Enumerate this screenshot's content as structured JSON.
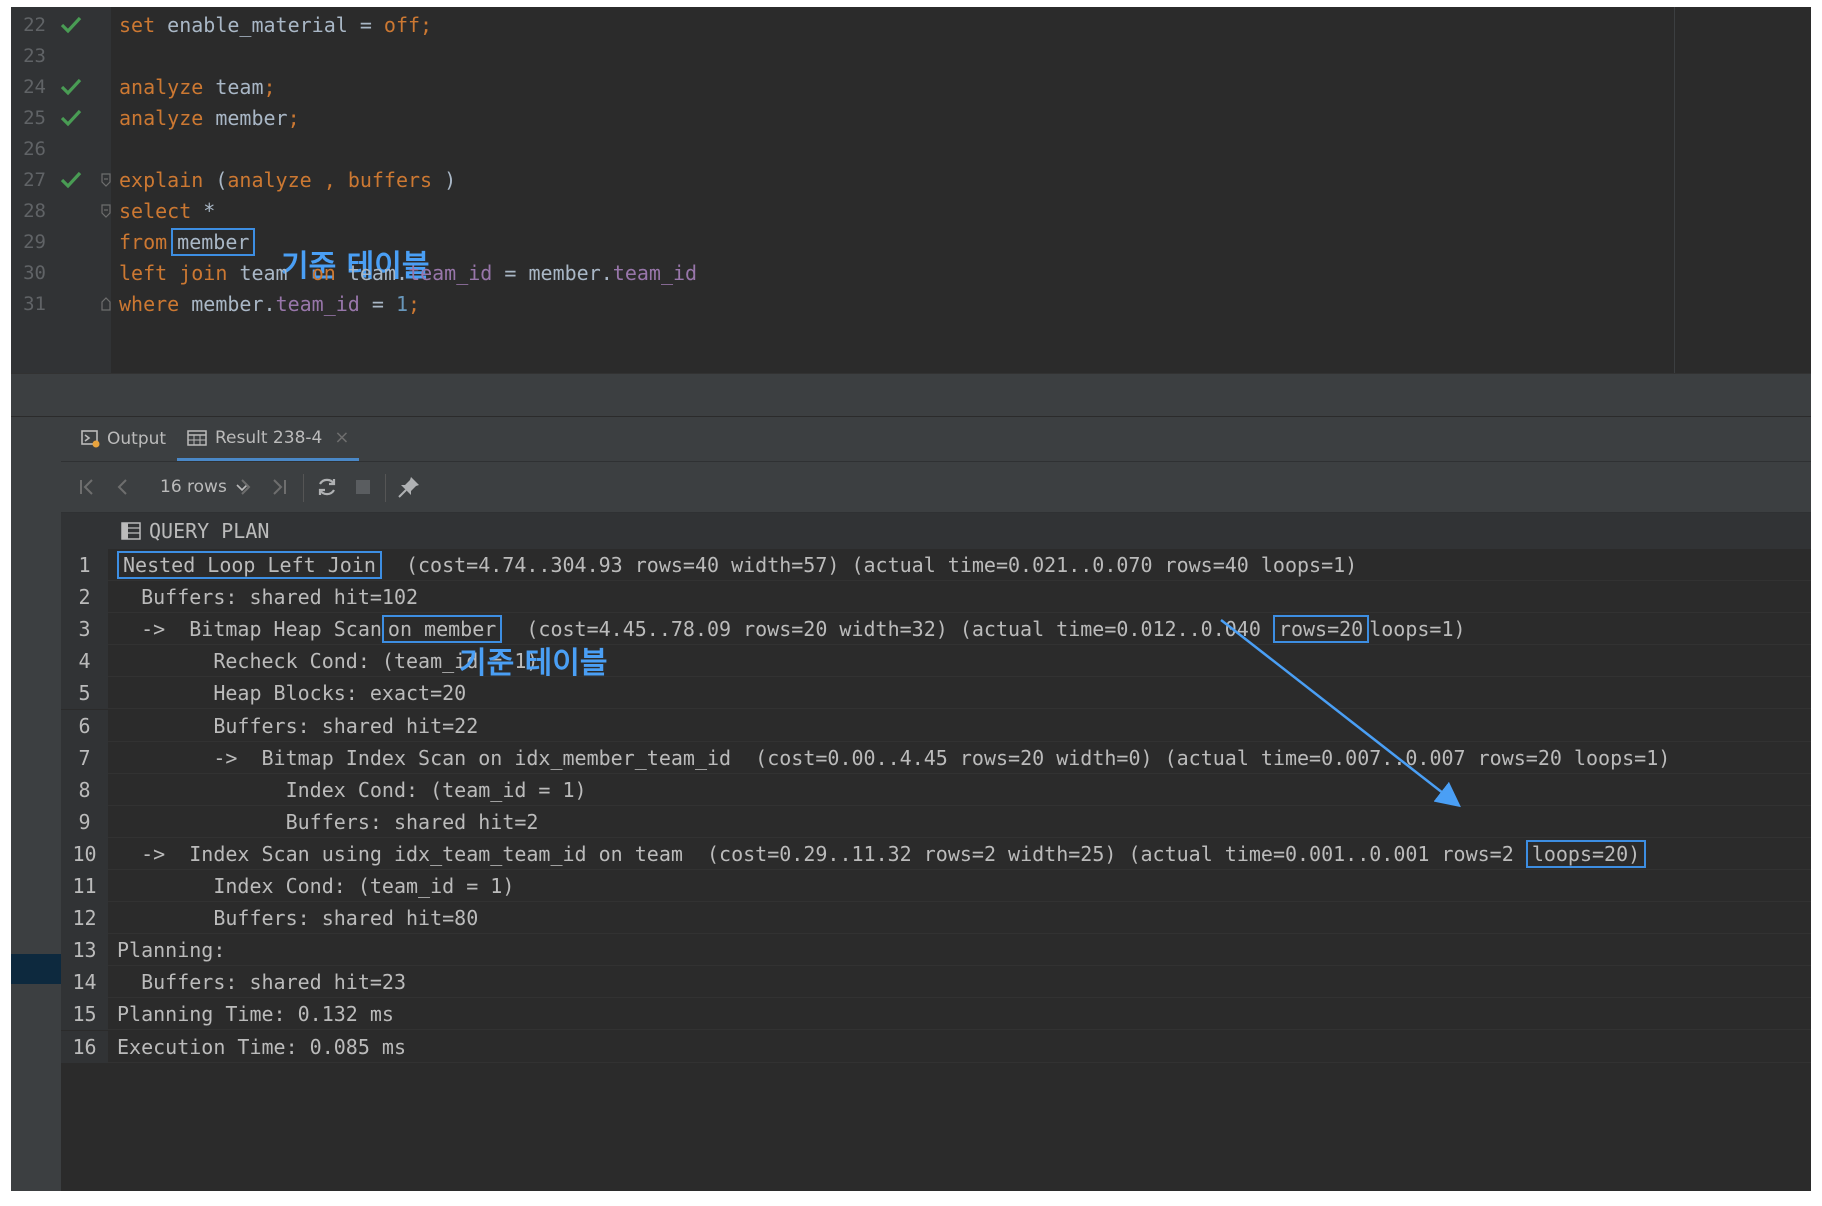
{
  "editor": {
    "lines": [
      {
        "num": "22",
        "check": true,
        "fold": false,
        "kind": "set"
      },
      {
        "num": "23",
        "check": false,
        "fold": false,
        "kind": "empty"
      },
      {
        "num": "24",
        "check": true,
        "fold": false,
        "kind": "analyze_team"
      },
      {
        "num": "25",
        "check": true,
        "fold": false,
        "kind": "analyze_member"
      },
      {
        "num": "26",
        "check": false,
        "fold": false,
        "kind": "empty"
      },
      {
        "num": "27",
        "check": true,
        "fold": true,
        "kind": "explain"
      },
      {
        "num": "28",
        "check": false,
        "fold": true,
        "kind": "select"
      },
      {
        "num": "29",
        "check": false,
        "fold": false,
        "kind": "from"
      },
      {
        "num": "30",
        "check": false,
        "fold": false,
        "kind": "join"
      },
      {
        "num": "31",
        "check": false,
        "fold": true,
        "kind": "where"
      }
    ],
    "tokens": {
      "set_kw": "set",
      "set_rest": " enable_material = ",
      "set_val": "off;",
      "analyze_kw": "analyze",
      "team": "team",
      "member": "member",
      "semicolon": ";",
      "explain_kw": "explain",
      "explain_open": " (",
      "explain_analyze": "analyze",
      "explain_comma": " , ",
      "explain_buffers": "buffers",
      "explain_close": " )",
      "select_kw": "select",
      "select_star": " *",
      "from_kw": "from",
      "left_kw": "left",
      "join_kw": "join",
      "on_kw": "on",
      "dot": ".",
      "team_id": "team_id",
      "equals": " = ",
      "where_kw": "where",
      "one": "1"
    },
    "annotation": "기준 테이블"
  },
  "tabs": [
    {
      "label": "Output",
      "icon": "output-console-icon",
      "active": false
    },
    {
      "label": "Result 238-4",
      "icon": "table-grid-icon",
      "active": true
    }
  ],
  "toolbar": {
    "rows_label": "16 rows",
    "icons": [
      "first-page-icon",
      "previous-page-icon",
      "next-page-icon",
      "last-page-icon",
      "refresh-icon",
      "stop-icon",
      "pin-icon"
    ]
  },
  "grid": {
    "column_header": "QUERY PLAN",
    "column_icon": "table-column-icon",
    "annotation": "기준 테이블",
    "rows": [
      {
        "n": "1",
        "parts": [
          {
            "t": "Nested Loop Left Join",
            "box": true
          },
          {
            "t": "  (cost=4.74..304.93 rows=40 width=57) (actual time=0.021..0.070 rows=40 loops=1)"
          }
        ]
      },
      {
        "n": "2",
        "parts": [
          {
            "t": "  Buffers: shared hit=102"
          }
        ]
      },
      {
        "n": "3",
        "parts": [
          {
            "t": "  ->  Bitmap Heap Scan"
          },
          {
            "t": "on member",
            "box": true
          },
          {
            "t": "  (cost=4.45..78.09 rows=20 width=32) (actual time=0.012..0.040 "
          },
          {
            "t": "rows=20",
            "box": true
          },
          {
            "t": "loops=1)"
          }
        ]
      },
      {
        "n": "4",
        "parts": [
          {
            "t": "        Recheck Cond: (team_id = 1)"
          }
        ]
      },
      {
        "n": "5",
        "parts": [
          {
            "t": "        Heap Blocks: exact=20"
          }
        ]
      },
      {
        "n": "6",
        "parts": [
          {
            "t": "        Buffers: shared hit=22"
          }
        ]
      },
      {
        "n": "7",
        "parts": [
          {
            "t": "        ->  Bitmap Index Scan on idx_member_team_id  (cost=0.00..4.45 rows=20 width=0) (actual time=0.007..0.007 rows=20 loops=1)"
          }
        ]
      },
      {
        "n": "8",
        "parts": [
          {
            "t": "              Index Cond: (team_id = 1)"
          }
        ]
      },
      {
        "n": "9",
        "parts": [
          {
            "t": "              Buffers: shared hit=2"
          }
        ]
      },
      {
        "n": "10",
        "parts": [
          {
            "t": "  ->  Index Scan using idx_team_team_id on team  (cost=0.29..11.32 rows=2 width=25) (actual time=0.001..0.001 rows=2 "
          },
          {
            "t": "loops=20)",
            "box": true
          }
        ]
      },
      {
        "n": "11",
        "parts": [
          {
            "t": "        Index Cond: (team_id = 1)"
          }
        ]
      },
      {
        "n": "12",
        "parts": [
          {
            "t": "        Buffers: shared hit=80"
          }
        ]
      },
      {
        "n": "13",
        "parts": [
          {
            "t": "Planning:"
          }
        ]
      },
      {
        "n": "14",
        "parts": [
          {
            "t": "  Buffers: shared hit=23"
          }
        ]
      },
      {
        "n": "15",
        "parts": [
          {
            "t": "Planning Time: 0.132 ms"
          }
        ]
      },
      {
        "n": "16",
        "parts": [
          {
            "t": "Execution Time: 0.085 ms"
          }
        ]
      }
    ]
  },
  "colors": {
    "keyword": "#cc7832",
    "field": "#9876aa",
    "number": "#6897bb",
    "text": "#a9b7c6",
    "highlight_box": "#3d8ee2",
    "annotation": "#4a9ff5",
    "check": "#499c54"
  }
}
